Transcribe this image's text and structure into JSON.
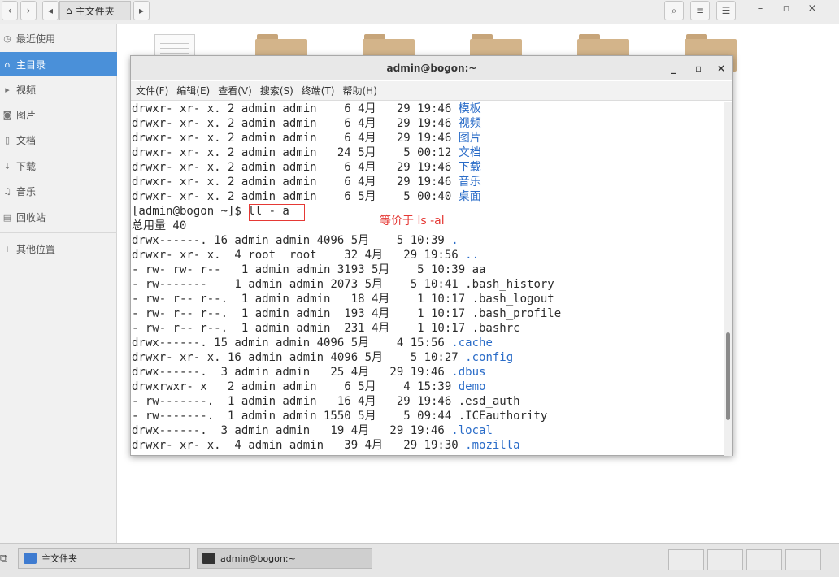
{
  "file_manager": {
    "breadcrumb": "主文件夹",
    "window_controls": {
      "minimize": "–",
      "maximize": "▫",
      "close": "×"
    }
  },
  "sidebar": {
    "items": [
      {
        "label": "最近使用",
        "icon": "clock-icon",
        "active": false
      },
      {
        "label": "主目录",
        "icon": "home-icon",
        "active": true
      },
      {
        "label": "视频",
        "icon": "video-icon",
        "active": false
      },
      {
        "label": "图片",
        "icon": "camera-icon",
        "active": false
      },
      {
        "label": "文档",
        "icon": "document-icon",
        "active": false
      },
      {
        "label": "下载",
        "icon": "download-icon",
        "active": false
      },
      {
        "label": "音乐",
        "icon": "music-icon",
        "active": false
      },
      {
        "label": "回收站",
        "icon": "trash-icon",
        "active": false
      },
      {
        "label": "其他位置",
        "icon": "plus-icon",
        "active": false
      }
    ]
  },
  "terminal": {
    "title": "admin@bogon:~",
    "controls": {
      "minimize": "_",
      "maximize": "▫",
      "close": "×"
    },
    "menu": [
      "文件(F)",
      "编辑(E)",
      "查看(V)",
      "搜索(S)",
      "终端(T)",
      "帮助(H)"
    ],
    "lines": [
      {
        "text": "drwxr- xr- x. 2 admin admin    6 4月   29 19:46 ",
        "name": "模板",
        "blue": true
      },
      {
        "text": "drwxr- xr- x. 2 admin admin    6 4月   29 19:46 ",
        "name": "视频",
        "blue": true
      },
      {
        "text": "drwxr- xr- x. 2 admin admin    6 4月   29 19:46 ",
        "name": "图片",
        "blue": true
      },
      {
        "text": "drwxr- xr- x. 2 admin admin   24 5月    5 00:12 ",
        "name": "文档",
        "blue": true
      },
      {
        "text": "drwxr- xr- x. 2 admin admin    6 4月   29 19:46 ",
        "name": "下载",
        "blue": true
      },
      {
        "text": "drwxr- xr- x. 2 admin admin    6 4月   29 19:46 ",
        "name": "音乐",
        "blue": true
      },
      {
        "text": "drwxr- xr- x. 2 admin admin    6 5月    5 00:40 ",
        "name": "桌面",
        "blue": true
      },
      {
        "text": "[admin@bogon ~]$ ll - a",
        "name": "",
        "blue": false
      },
      {
        "text": "总用量 40",
        "name": "",
        "blue": false
      },
      {
        "text": "drwx------. 16 admin admin 4096 5月    5 10:39 ",
        "name": ".",
        "blue": true
      },
      {
        "text": "drwxr- xr- x.  4 root  root    32 4月   29 19:56 ",
        "name": "..",
        "blue": true
      },
      {
        "text": "- rw- rw- r--   1 admin admin 3193 5月    5 10:39 ",
        "name": "aa",
        "blue": false
      },
      {
        "text": "- rw-------    1 admin admin 2073 5月    5 10:41 ",
        "name": ".bash_history",
        "blue": false
      },
      {
        "text": "- rw- r-- r--.  1 admin admin   18 4月    1 10:17 ",
        "name": ".bash_logout",
        "blue": false
      },
      {
        "text": "- rw- r-- r--.  1 admin admin  193 4月    1 10:17 ",
        "name": ".bash_profile",
        "blue": false
      },
      {
        "text": "- rw- r-- r--.  1 admin admin  231 4月    1 10:17 ",
        "name": ".bashrc",
        "blue": false
      },
      {
        "text": "drwx------. 15 admin admin 4096 5月    4 15:56 ",
        "name": ".cache",
        "blue": true
      },
      {
        "text": "drwxr- xr- x. 16 admin admin 4096 5月    5 10:27 ",
        "name": ".config",
        "blue": true
      },
      {
        "text": "drwx------.  3 admin admin   25 4月   29 19:46 ",
        "name": ".dbus",
        "blue": true
      },
      {
        "text": "drwxrwxr- x   2 admin admin    6 5月    4 15:39 ",
        "name": "demo",
        "blue": true
      },
      {
        "text": "- rw-------.  1 admin admin   16 4月   29 19:46 ",
        "name": ".esd_auth",
        "blue": false
      },
      {
        "text": "- rw-------.  1 admin admin 1550 5月    5 09:44 ",
        "name": ".ICEauthority",
        "blue": false
      },
      {
        "text": "drwx------.  3 admin admin   19 4月   29 19:46 ",
        "name": ".local",
        "blue": true
      },
      {
        "text": "drwxr- xr- x.  4 admin admin   39 4月   29 19:30 ",
        "name": ".mozilla",
        "blue": true
      }
    ],
    "annotation": "等价于 ls -al"
  },
  "taskbar": {
    "items": [
      {
        "label": "主文件夹",
        "icon": "file-manager-icon"
      },
      {
        "label": "admin@bogon:~",
        "icon": "terminal-icon"
      }
    ]
  },
  "colors": {
    "accent": "#4a90d9",
    "dir_blue": "#2a6cc8",
    "annotation_red": "#e53935"
  }
}
